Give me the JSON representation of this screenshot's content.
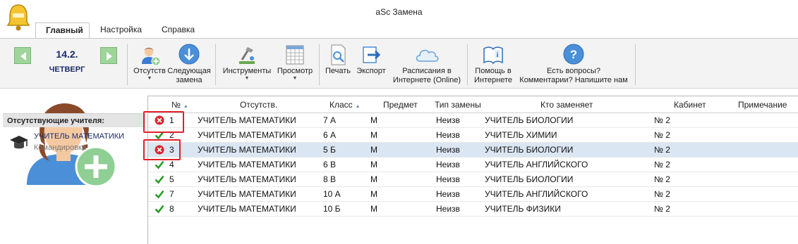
{
  "window": {
    "title": "aSc Замена"
  },
  "tabs": [
    {
      "label": "Главный",
      "active": true
    },
    {
      "label": "Настройка",
      "active": false
    },
    {
      "label": "Справка",
      "active": false
    }
  ],
  "ribbon": {
    "date": "14.2.",
    "weekday": "ЧЕТВЕРГ",
    "absent_line1": "Отсутств",
    "next_line1": "Следующая",
    "next_line2": "замена",
    "tools": "Инструменты",
    "view": "Просмотр",
    "print": "Печать",
    "export": "Экспорт",
    "online_line1": "Расписания в",
    "online_line2": "Интернете (Online)",
    "help_line1": "Помощь в",
    "help_line2": "Интернете",
    "questions_line1": "Есть вопросы?",
    "questions_line2": "Комментарии? Напишите нам"
  },
  "absent_panel": {
    "header": "Отсутствующие учителя:",
    "teacher": "УЧИТЕЛЬ МАТЕМАТИКИ",
    "reason": "Командировка"
  },
  "grid": {
    "columns": {
      "num": "№",
      "absent": "Отсутств.",
      "class": "Класс",
      "subject": "Предмет",
      "type": "Тип замены",
      "replacer": "Кто заменяет",
      "room": "Кабинет",
      "note": "Примечание"
    },
    "rows": [
      {
        "status": "error",
        "num": "1",
        "absent": "УЧИТЕЛЬ МАТЕМАТИКИ",
        "class": "7 А",
        "subject": "М",
        "type": "Неизв",
        "replacer": "УЧИТЕЛЬ БИОЛОГИИ",
        "room": "№ 2",
        "note": ""
      },
      {
        "status": "ok",
        "num": "2",
        "absent": "УЧИТЕЛЬ МАТЕМАТИКИ",
        "class": "6 А",
        "subject": "М",
        "type": "Неизв",
        "replacer": "УЧИТЕЛЬ ХИМИИ",
        "room": "№ 2",
        "note": ""
      },
      {
        "status": "error",
        "num": "3",
        "absent": "УЧИТЕЛЬ МАТЕМАТИКИ",
        "class": "5 Б",
        "subject": "М",
        "type": "Неизв",
        "replacer": "УЧИТЕЛЬ БИОЛОГИИ",
        "room": "№ 2",
        "note": ""
      },
      {
        "status": "ok",
        "num": "4",
        "absent": "УЧИТЕЛЬ МАТЕМАТИКИ",
        "class": "6 В",
        "subject": "М",
        "type": "Неизв",
        "replacer": "УЧИТЕЛЬ АНГЛИЙСКОГО",
        "room": "№ 2",
        "note": ""
      },
      {
        "status": "ok",
        "num": "5",
        "absent": "УЧИТЕЛЬ МАТЕМАТИКИ",
        "class": "8 В",
        "subject": "М",
        "type": "Неизв",
        "replacer": "УЧИТЕЛЬ БИОЛОГИИ",
        "room": "№ 2",
        "note": ""
      },
      {
        "status": "ok",
        "num": "7",
        "absent": "УЧИТЕЛЬ МАТЕМАТИКИ",
        "class": "10 А",
        "subject": "М",
        "type": "Неизв",
        "replacer": "УЧИТЕЛЬ АНГЛИЙСКОГО",
        "room": "№ 2",
        "note": ""
      },
      {
        "status": "ok",
        "num": "8",
        "absent": "УЧИТЕЛЬ МАТЕМАТИКИ",
        "class": "10 Б",
        "subject": "М",
        "type": "Неизв",
        "replacer": "УЧИТЕЛЬ ФИЗИКИ",
        "room": "№ 2",
        "note": ""
      }
    ]
  },
  "colors": {
    "accent": "#1a2a6a",
    "selected_row": "#dbe6f3",
    "highlight": "#e0202a",
    "ok": "#2a9a2a",
    "error": "#d9262c"
  }
}
